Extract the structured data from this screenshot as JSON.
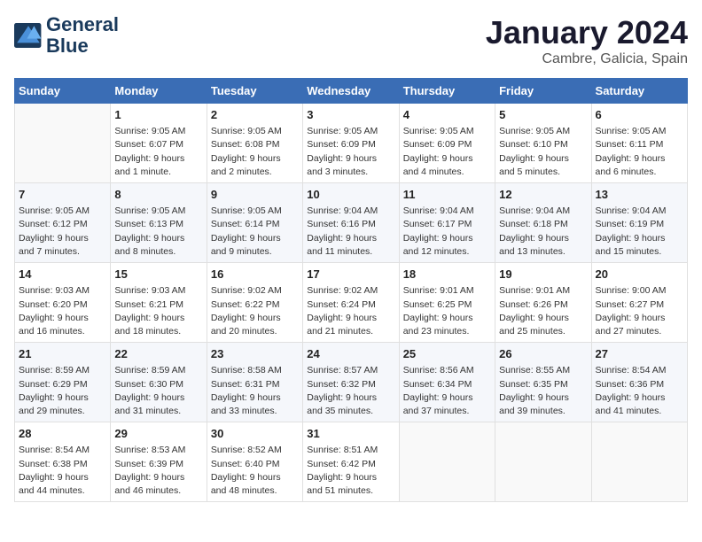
{
  "logo": {
    "line1": "General",
    "line2": "Blue"
  },
  "title": "January 2024",
  "subtitle": "Cambre, Galicia, Spain",
  "weekdays": [
    "Sunday",
    "Monday",
    "Tuesday",
    "Wednesday",
    "Thursday",
    "Friday",
    "Saturday"
  ],
  "weeks": [
    [
      {
        "day": "",
        "info": ""
      },
      {
        "day": "1",
        "info": "Sunrise: 9:05 AM\nSunset: 6:07 PM\nDaylight: 9 hours\nand 1 minute."
      },
      {
        "day": "2",
        "info": "Sunrise: 9:05 AM\nSunset: 6:08 PM\nDaylight: 9 hours\nand 2 minutes."
      },
      {
        "day": "3",
        "info": "Sunrise: 9:05 AM\nSunset: 6:09 PM\nDaylight: 9 hours\nand 3 minutes."
      },
      {
        "day": "4",
        "info": "Sunrise: 9:05 AM\nSunset: 6:09 PM\nDaylight: 9 hours\nand 4 minutes."
      },
      {
        "day": "5",
        "info": "Sunrise: 9:05 AM\nSunset: 6:10 PM\nDaylight: 9 hours\nand 5 minutes."
      },
      {
        "day": "6",
        "info": "Sunrise: 9:05 AM\nSunset: 6:11 PM\nDaylight: 9 hours\nand 6 minutes."
      }
    ],
    [
      {
        "day": "7",
        "info": "Sunrise: 9:05 AM\nSunset: 6:12 PM\nDaylight: 9 hours\nand 7 minutes."
      },
      {
        "day": "8",
        "info": "Sunrise: 9:05 AM\nSunset: 6:13 PM\nDaylight: 9 hours\nand 8 minutes."
      },
      {
        "day": "9",
        "info": "Sunrise: 9:05 AM\nSunset: 6:14 PM\nDaylight: 9 hours\nand 9 minutes."
      },
      {
        "day": "10",
        "info": "Sunrise: 9:04 AM\nSunset: 6:16 PM\nDaylight: 9 hours\nand 11 minutes."
      },
      {
        "day": "11",
        "info": "Sunrise: 9:04 AM\nSunset: 6:17 PM\nDaylight: 9 hours\nand 12 minutes."
      },
      {
        "day": "12",
        "info": "Sunrise: 9:04 AM\nSunset: 6:18 PM\nDaylight: 9 hours\nand 13 minutes."
      },
      {
        "day": "13",
        "info": "Sunrise: 9:04 AM\nSunset: 6:19 PM\nDaylight: 9 hours\nand 15 minutes."
      }
    ],
    [
      {
        "day": "14",
        "info": "Sunrise: 9:03 AM\nSunset: 6:20 PM\nDaylight: 9 hours\nand 16 minutes."
      },
      {
        "day": "15",
        "info": "Sunrise: 9:03 AM\nSunset: 6:21 PM\nDaylight: 9 hours\nand 18 minutes."
      },
      {
        "day": "16",
        "info": "Sunrise: 9:02 AM\nSunset: 6:22 PM\nDaylight: 9 hours\nand 20 minutes."
      },
      {
        "day": "17",
        "info": "Sunrise: 9:02 AM\nSunset: 6:24 PM\nDaylight: 9 hours\nand 21 minutes."
      },
      {
        "day": "18",
        "info": "Sunrise: 9:01 AM\nSunset: 6:25 PM\nDaylight: 9 hours\nand 23 minutes."
      },
      {
        "day": "19",
        "info": "Sunrise: 9:01 AM\nSunset: 6:26 PM\nDaylight: 9 hours\nand 25 minutes."
      },
      {
        "day": "20",
        "info": "Sunrise: 9:00 AM\nSunset: 6:27 PM\nDaylight: 9 hours\nand 27 minutes."
      }
    ],
    [
      {
        "day": "21",
        "info": "Sunrise: 8:59 AM\nSunset: 6:29 PM\nDaylight: 9 hours\nand 29 minutes."
      },
      {
        "day": "22",
        "info": "Sunrise: 8:59 AM\nSunset: 6:30 PM\nDaylight: 9 hours\nand 31 minutes."
      },
      {
        "day": "23",
        "info": "Sunrise: 8:58 AM\nSunset: 6:31 PM\nDaylight: 9 hours\nand 33 minutes."
      },
      {
        "day": "24",
        "info": "Sunrise: 8:57 AM\nSunset: 6:32 PM\nDaylight: 9 hours\nand 35 minutes."
      },
      {
        "day": "25",
        "info": "Sunrise: 8:56 AM\nSunset: 6:34 PM\nDaylight: 9 hours\nand 37 minutes."
      },
      {
        "day": "26",
        "info": "Sunrise: 8:55 AM\nSunset: 6:35 PM\nDaylight: 9 hours\nand 39 minutes."
      },
      {
        "day": "27",
        "info": "Sunrise: 8:54 AM\nSunset: 6:36 PM\nDaylight: 9 hours\nand 41 minutes."
      }
    ],
    [
      {
        "day": "28",
        "info": "Sunrise: 8:54 AM\nSunset: 6:38 PM\nDaylight: 9 hours\nand 44 minutes."
      },
      {
        "day": "29",
        "info": "Sunrise: 8:53 AM\nSunset: 6:39 PM\nDaylight: 9 hours\nand 46 minutes."
      },
      {
        "day": "30",
        "info": "Sunrise: 8:52 AM\nSunset: 6:40 PM\nDaylight: 9 hours\nand 48 minutes."
      },
      {
        "day": "31",
        "info": "Sunrise: 8:51 AM\nSunset: 6:42 PM\nDaylight: 9 hours\nand 51 minutes."
      },
      {
        "day": "",
        "info": ""
      },
      {
        "day": "",
        "info": ""
      },
      {
        "day": "",
        "info": ""
      }
    ]
  ]
}
